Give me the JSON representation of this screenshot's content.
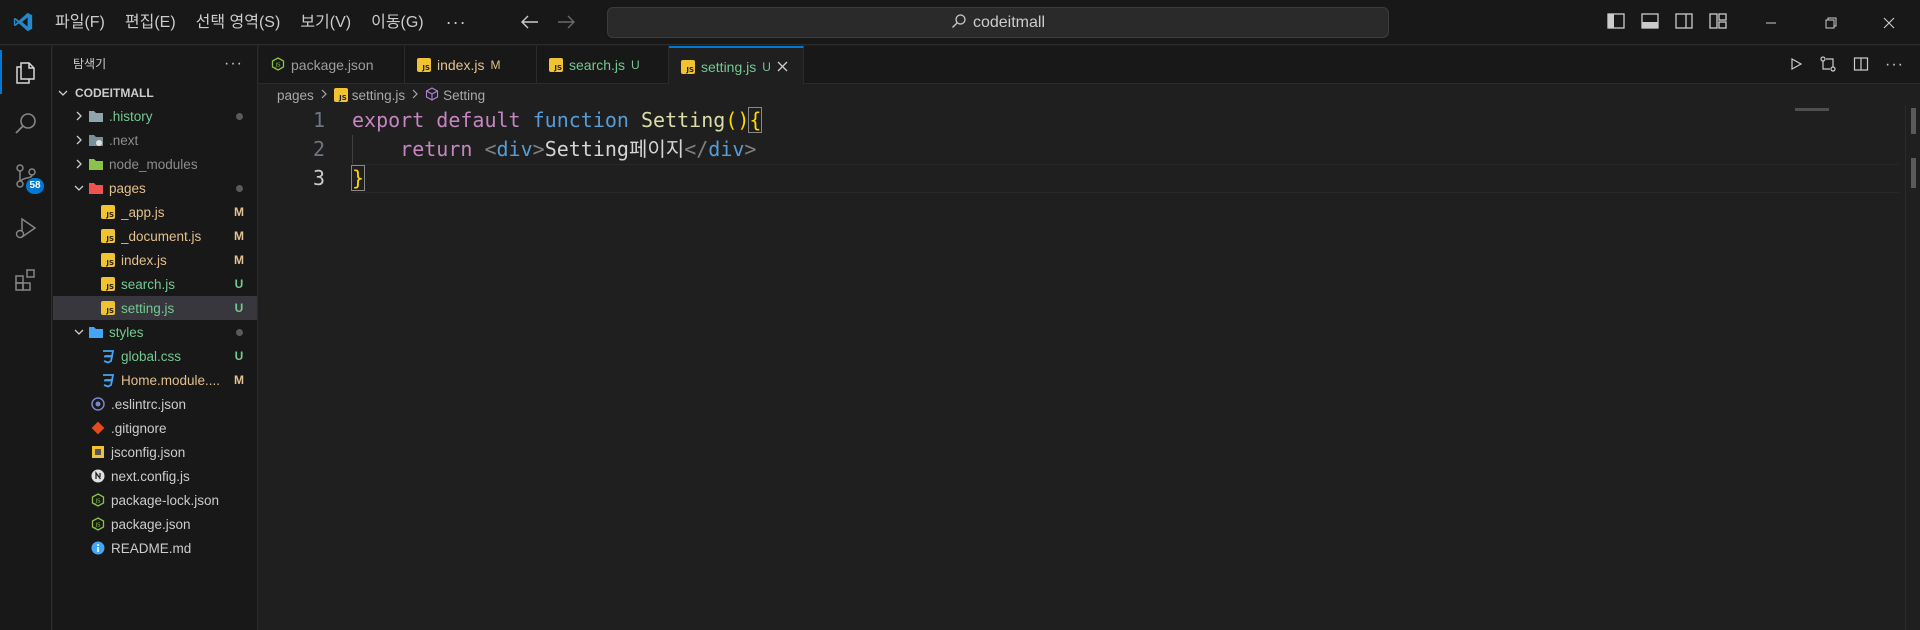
{
  "titlebar": {
    "menu": [
      "파일(F)",
      "편집(E)",
      "선택 영역(S)",
      "보기(V)",
      "이동(G)"
    ],
    "more": "···",
    "search_text": "codeitmall"
  },
  "activity": {
    "scm_badge": "58"
  },
  "sidebar": {
    "title": "탐색기",
    "more": "···",
    "root": "CODEITMALL",
    "items": [
      {
        "name": ".history",
        "status": "",
        "color": "new"
      },
      {
        "name": ".next",
        "status": "",
        "color": "ign"
      },
      {
        "name": "node_modules",
        "status": "",
        "color": "ign"
      },
      {
        "name": "pages",
        "status": "",
        "color": "mod"
      },
      {
        "name": "_app.js",
        "status": "M",
        "color": "mod"
      },
      {
        "name": "_document.js",
        "status": "M",
        "color": "mod"
      },
      {
        "name": "index.js",
        "status": "M",
        "color": "mod"
      },
      {
        "name": "search.js",
        "status": "U",
        "color": "new"
      },
      {
        "name": "setting.js",
        "status": "U",
        "color": "new"
      },
      {
        "name": "styles",
        "status": "",
        "color": "new"
      },
      {
        "name": "global.css",
        "status": "U",
        "color": "new"
      },
      {
        "name": "Home.module....",
        "status": "M",
        "color": "mod"
      },
      {
        "name": ".eslintrc.json",
        "status": "",
        "color": "norm"
      },
      {
        "name": ".gitignore",
        "status": "",
        "color": "norm"
      },
      {
        "name": "jsconfig.json",
        "status": "",
        "color": "norm"
      },
      {
        "name": "next.config.js",
        "status": "",
        "color": "norm"
      },
      {
        "name": "package-lock.json",
        "status": "",
        "color": "norm"
      },
      {
        "name": "package.json",
        "status": "",
        "color": "norm"
      },
      {
        "name": "README.md",
        "status": "",
        "color": "norm"
      }
    ]
  },
  "tabs": [
    {
      "label": "package.json",
      "status": ""
    },
    {
      "label": "index.js",
      "status": "M"
    },
    {
      "label": "search.js",
      "status": "U"
    },
    {
      "label": "setting.js",
      "status": "U"
    }
  ],
  "breadcrumb": [
    "pages",
    "setting.js",
    "Setting"
  ],
  "code": {
    "line_numbers": [
      "1",
      "2",
      "3"
    ],
    "l1": {
      "export": "export",
      "default": "default",
      "function": "function",
      "name": "Setting",
      "paren_open": "(",
      "paren_close": ")",
      "brace": "{"
    },
    "l2": {
      "return": "return",
      "lt": "<",
      "tag_open": "div",
      "gt": ">",
      "text": "Setting페이지",
      "lt_close": "</",
      "tag_close": "div",
      "gt_close": ">"
    },
    "l3": {
      "brace": "}"
    }
  }
}
